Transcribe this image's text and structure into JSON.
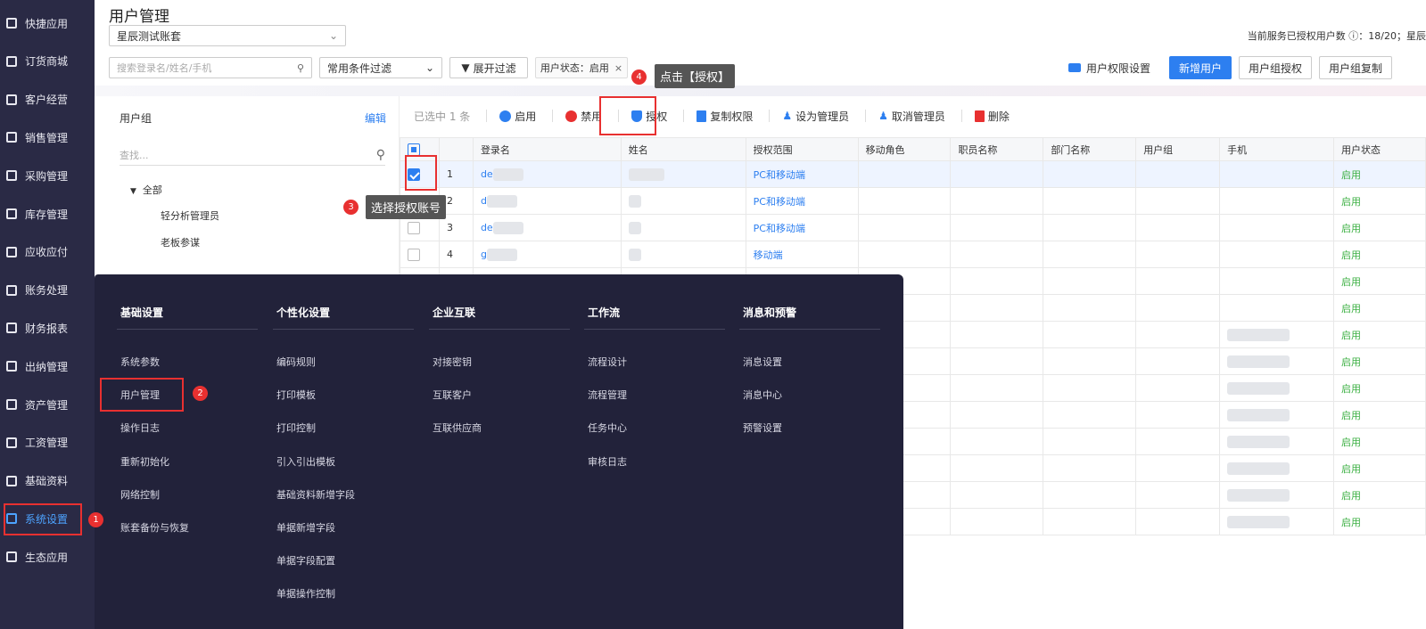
{
  "sidebar": {
    "items": [
      {
        "label": "快捷应用",
        "icon": "grid-icon"
      },
      {
        "label": "订货商城",
        "icon": "bag-icon"
      },
      {
        "label": "客户经营",
        "icon": "customer-icon"
      },
      {
        "label": "销售管理",
        "icon": "sales-icon"
      },
      {
        "label": "采购管理",
        "icon": "cart-icon"
      },
      {
        "label": "库存管理",
        "icon": "box-icon"
      },
      {
        "label": "应收应付",
        "icon": "money-icon"
      },
      {
        "label": "账务处理",
        "icon": "ledger-icon"
      },
      {
        "label": "财务报表",
        "icon": "report-icon"
      },
      {
        "label": "出纳管理",
        "icon": "cashier-icon"
      },
      {
        "label": "资产管理",
        "icon": "asset-icon"
      },
      {
        "label": "工资管理",
        "icon": "salary-icon"
      },
      {
        "label": "基础资料",
        "icon": "layers-icon"
      },
      {
        "label": "系统设置",
        "icon": "settings-icon",
        "active": true
      },
      {
        "label": "生态应用",
        "icon": "eco-icon"
      }
    ]
  },
  "header": {
    "title": "用户管理",
    "account": "星辰测试账套",
    "search_placeholder": "搜索登录名/姓名/手机",
    "filter_select": "常用条件过滤",
    "expand_filter": "展开过滤",
    "status_tag": "用户状态：启用",
    "licensed_info": "当前服务已授权用户数 ⓘ：18/20；星辰",
    "perm_settings": "用户权限设置",
    "add_user": "新增用户",
    "group_auth": "用户组授权",
    "group_copy": "用户组复制"
  },
  "groups": {
    "title": "用户组",
    "edit": "编辑",
    "search_placeholder": "查找...",
    "root": "全部",
    "children": [
      "轻分析管理员",
      "老板参谋"
    ]
  },
  "toolbar": {
    "selected": "已选中 1 条",
    "enable": "启用",
    "disable": "禁用",
    "authorize": "授权",
    "copy_perm": "复制权限",
    "set_admin": "设为管理员",
    "cancel_admin": "取消管理员",
    "delete": "删除"
  },
  "table": {
    "columns": [
      "",
      "",
      "登录名",
      "姓名",
      "授权范围",
      "移动角色",
      "职员名称",
      "部门名称",
      "用户组",
      "手机",
      "用户状态"
    ],
    "rows": [
      {
        "num": "1",
        "login": "de",
        "scope": "PC和移动端",
        "status": "启用",
        "checked": true
      },
      {
        "num": "2",
        "login": "d",
        "scope": "PC和移动端",
        "status": "启用",
        "checked": false
      },
      {
        "num": "3",
        "login": "de",
        "scope": "PC和移动端",
        "status": "启用",
        "checked": false
      },
      {
        "num": "4",
        "login": "g",
        "scope": "移动端",
        "status": "启用",
        "checked": false
      },
      {
        "num": "",
        "login": "",
        "scope": "",
        "status": "启用",
        "checked": false
      },
      {
        "num": "",
        "login": "",
        "scope": "",
        "status": "启用",
        "checked": false
      },
      {
        "num": "",
        "login": "",
        "scope": "",
        "status": "启用",
        "checked": false
      },
      {
        "num": "",
        "login": "",
        "scope": "",
        "status": "启用",
        "checked": false
      },
      {
        "num": "",
        "login": "",
        "scope": "",
        "status": "启用",
        "checked": false
      },
      {
        "num": "",
        "login": "",
        "scope": "",
        "status": "启用",
        "checked": false
      },
      {
        "num": "",
        "login": "",
        "scope": "",
        "status": "启用",
        "checked": false
      },
      {
        "num": "",
        "login": "",
        "scope": "",
        "status": "启用",
        "checked": false
      },
      {
        "num": "",
        "login": "",
        "scope": "",
        "status": "启用",
        "checked": false
      },
      {
        "num": "",
        "login": "",
        "scope": "",
        "status": "启用",
        "checked": false
      }
    ]
  },
  "menu": {
    "columns": [
      {
        "title": "基础设置",
        "items": [
          "系统参数",
          "用户管理",
          "操作日志",
          "重新初始化",
          "网络控制",
          "账套备份与恢复"
        ]
      },
      {
        "title": "个性化设置",
        "items": [
          "编码规则",
          "打印模板",
          "打印控制",
          "引入引出模板",
          "基础资料新增字段",
          "单据新增字段",
          "单据字段配置",
          "单据操作控制"
        ]
      },
      {
        "title": "企业互联",
        "items": [
          "对接密钥",
          "互联客户",
          "互联供应商"
        ]
      },
      {
        "title": "工作流",
        "items": [
          "流程设计",
          "流程管理",
          "任务中心",
          "审核日志"
        ]
      },
      {
        "title": "消息和预警",
        "items": [
          "消息设置",
          "消息中心",
          "预警设置"
        ]
      }
    ]
  },
  "annotations": {
    "step1": "1",
    "step2": "2",
    "step3": "3",
    "step3_text": "选择授权账号",
    "step4": "4",
    "step4_text": "点击【授权】"
  },
  "colors": {
    "accent": "#2d7ff0",
    "sidebar_bg": "#2a2a45",
    "menu_bg": "#22223a",
    "highlight": "#e83030",
    "status_green": "#3cb043"
  }
}
